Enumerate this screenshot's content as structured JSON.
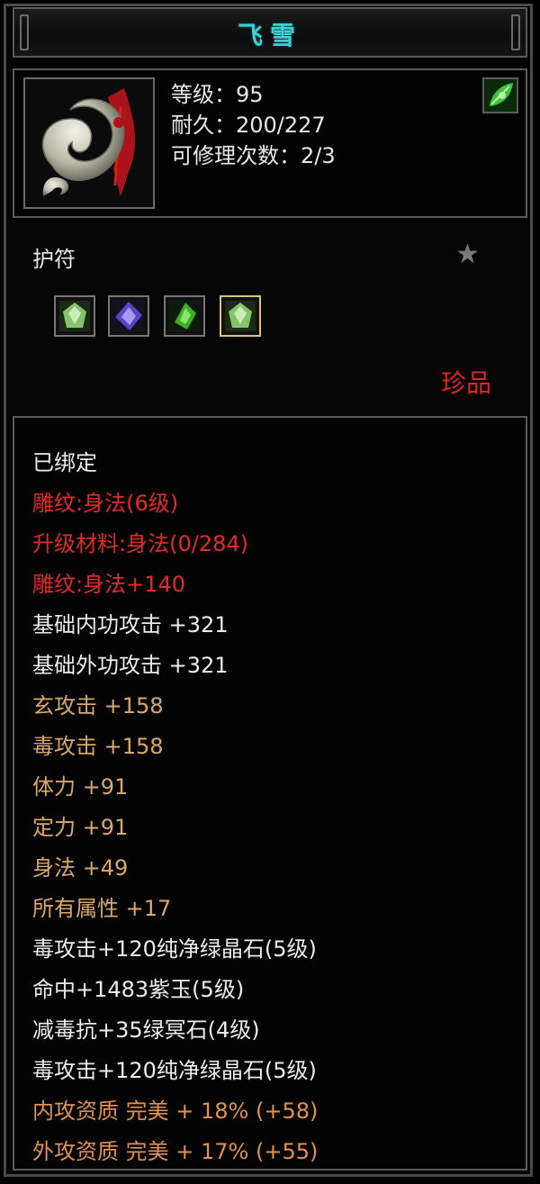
{
  "title": "飞雪",
  "item": {
    "image_icon": "jade-amulet-icon",
    "type_icon": "green-leaf-icon",
    "stats": [
      "等级：95",
      "耐久：200/227",
      "可修理次数：2/3"
    ]
  },
  "category": "护符",
  "favorite_icon": "star-icon",
  "gems": [
    {
      "icon": "green-crystal-gem-icon",
      "color": "#7fbf6a"
    },
    {
      "icon": "purple-jade-gem-icon",
      "color": "#5a4cc8"
    },
    {
      "icon": "green-dark-crystal-gem-icon",
      "color": "#3fb02a"
    },
    {
      "icon": "green-crystal-gem-icon",
      "color": "#7fbf6a"
    }
  ],
  "rarity": "珍品",
  "properties": [
    {
      "text": "已绑定",
      "color": "white"
    },
    {
      "text": "雕纹:身法(6级)",
      "color": "red"
    },
    {
      "text": "升级材料:身法(0/284)",
      "color": "red"
    },
    {
      "text": "雕纹:身法+140",
      "color": "red"
    },
    {
      "text": "基础内功攻击 +321",
      "color": "white"
    },
    {
      "text": "基础外功攻击 +321",
      "color": "white"
    },
    {
      "text": "玄攻击 +158",
      "color": "gold"
    },
    {
      "text": "毒攻击 +158",
      "color": "gold"
    },
    {
      "text": "体力 +91",
      "color": "gold"
    },
    {
      "text": "定力 +91",
      "color": "gold"
    },
    {
      "text": "身法 +49",
      "color": "gold"
    },
    {
      "text": "所有属性 +17",
      "color": "gold"
    },
    {
      "text": "毒攻击+120纯净绿晶石(5级)",
      "color": "white"
    },
    {
      "text": "命中+1483紫玉(5级)",
      "color": "white"
    },
    {
      "text": "减毒抗+35绿冥石(4级)",
      "color": "white"
    },
    {
      "text": "毒攻击+120纯净绿晶石(5级)",
      "color": "white"
    },
    {
      "text": "内攻资质 完美 + 18% (+58)",
      "color": "orange"
    },
    {
      "text": "外攻资质 完美 + 17% (+55)",
      "color": "orange"
    }
  ]
}
